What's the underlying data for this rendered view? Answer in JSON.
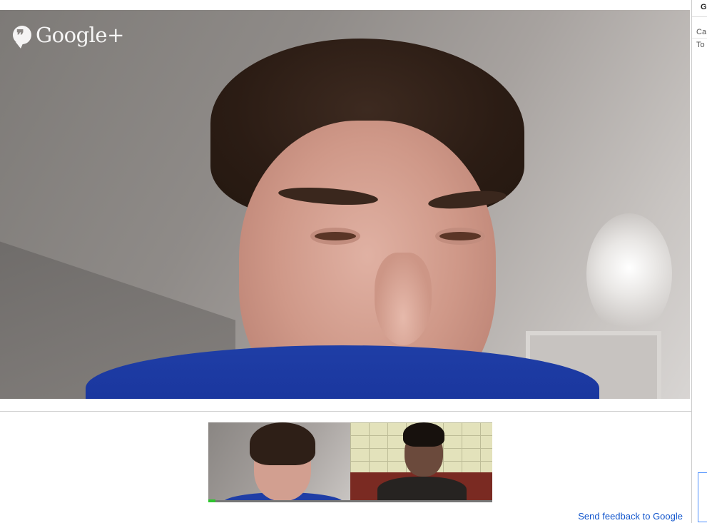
{
  "app": {
    "logo_text": "Google+",
    "logo_icon": "hangouts-quote-icon"
  },
  "main_video": {
    "participant": "main-participant"
  },
  "thumbnails": [
    {
      "name": "participant-1",
      "speaking": true,
      "speaking_level": 0.05
    },
    {
      "name": "participant-2",
      "speaking": false
    }
  ],
  "footer": {
    "feedback_link": "Send feedback to Google"
  },
  "side_panel": {
    "header": "G",
    "rows": [
      "Ca",
      "To"
    ]
  },
  "colors": {
    "link": "#1155cc",
    "speaking_indicator": "#2ec42e",
    "shirt_blue": "#1f3ea6"
  }
}
